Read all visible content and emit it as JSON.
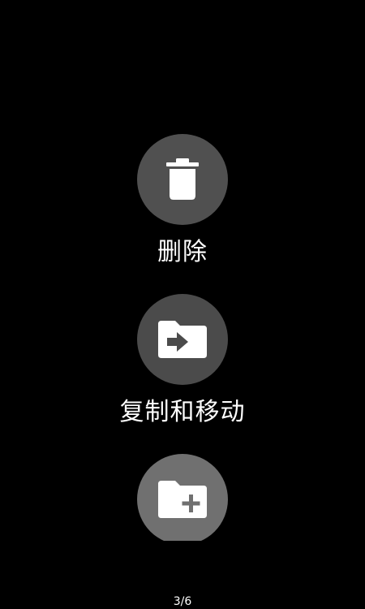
{
  "actions": [
    {
      "id": "delete",
      "label": "删除",
      "icon": "trash-icon",
      "circle_color": "#505050"
    },
    {
      "id": "move",
      "label": "复制和移动",
      "icon": "folder-move-icon",
      "circle_color": "#4b4b4b"
    },
    {
      "id": "new",
      "label": "",
      "icon": "folder-add-icon",
      "circle_color": "#707070"
    }
  ],
  "pager": {
    "text": "3/6"
  },
  "colors": {
    "background": "#000000",
    "icon": "#ffffff",
    "text": "#ffffff"
  }
}
